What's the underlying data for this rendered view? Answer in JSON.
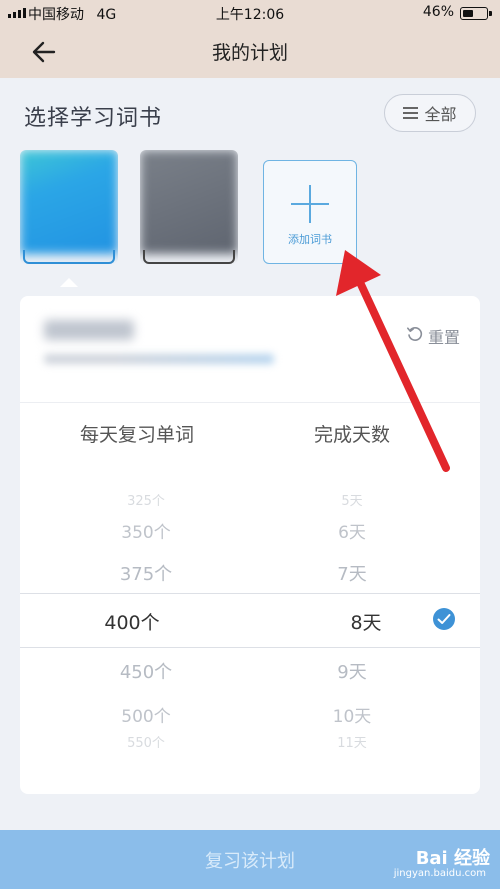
{
  "status_bar": {
    "carrier": "中国移动",
    "network": "4G",
    "time": "上午12:06",
    "battery_percent": "46%",
    "battery_level": 0.46
  },
  "nav": {
    "title": "我的计划",
    "back_icon": "back-arrow-icon"
  },
  "book_section": {
    "title": "选择学习词书",
    "all_button": "全部",
    "add_label": "添加词书"
  },
  "plan": {
    "reset_label": "重置"
  },
  "picker": {
    "left_header": "每天复习单词",
    "right_header": "完成天数",
    "left_above": [
      "325个",
      "350个",
      "375个"
    ],
    "left_selected": "400个",
    "left_below": [
      "450个",
      "500个",
      "550个"
    ],
    "right_above": [
      "5天",
      "6天",
      "7天"
    ],
    "right_selected": "8天",
    "right_below": [
      "9天",
      "10天",
      "11天"
    ]
  },
  "bottom_button": "复习该计划",
  "watermark": {
    "brand": "Bai 经验",
    "url": "jingyan.baidu.com"
  },
  "colors": {
    "accent": "#3e92d6",
    "button": "#8bbdea",
    "annotation_arrow": "#e2262b"
  }
}
